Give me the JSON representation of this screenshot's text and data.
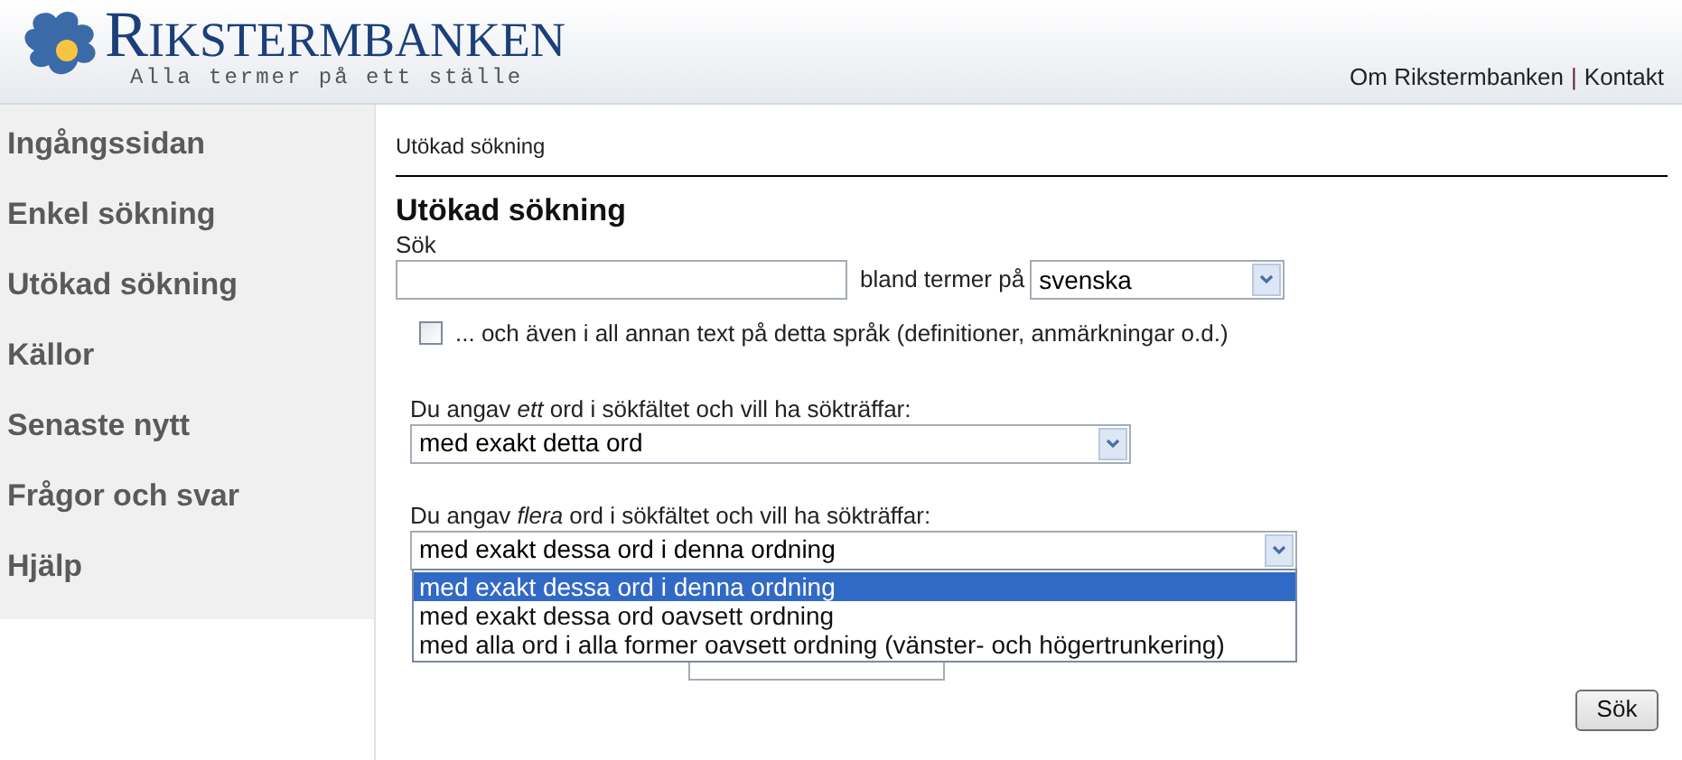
{
  "header": {
    "logo_title": "RIKSTERMBANKEN",
    "logo_tagline": "Alla termer på ett ställe",
    "links": [
      {
        "label": "Om Rikstermbanken"
      },
      {
        "label": "Kontakt"
      }
    ],
    "separator": "|"
  },
  "sidebar": {
    "items": [
      {
        "label": "Ingångssidan"
      },
      {
        "label": "Enkel sökning"
      },
      {
        "label": "Utökad sökning"
      },
      {
        "label": "Källor"
      },
      {
        "label": "Senaste nytt"
      },
      {
        "label": "Frågor och svar"
      },
      {
        "label": "Hjälp"
      }
    ]
  },
  "breadcrumb": "Utökad sökning",
  "heading": "Utökad sökning",
  "search": {
    "label": "Sök",
    "language_label": "bland termer på",
    "language_value": "svenska"
  },
  "also_text": {
    "checked": false,
    "label": "... och även i all annan text på detta språk (definitioner, anmärkningar o.d.)"
  },
  "one_word": {
    "label": "Du angav *ett* ord i sökfältet och vill ha sökträffar:",
    "value": "med exakt detta ord"
  },
  "many_words": {
    "label": "Du angav *flera* ord i sökfältet och vill ha sökträffar:",
    "value": "med exakt dessa ord i denna ordning",
    "expanded": true,
    "options": [
      {
        "label": "med exakt dessa ord i denna ordning",
        "selected": true
      },
      {
        "label": "med exakt dessa ord oavsett ordning",
        "selected": false
      },
      {
        "label": "med alla ord i alla former oavsett ordning (vänster- och högertrunkering)",
        "selected": false
      }
    ]
  },
  "submit": "Sök"
}
